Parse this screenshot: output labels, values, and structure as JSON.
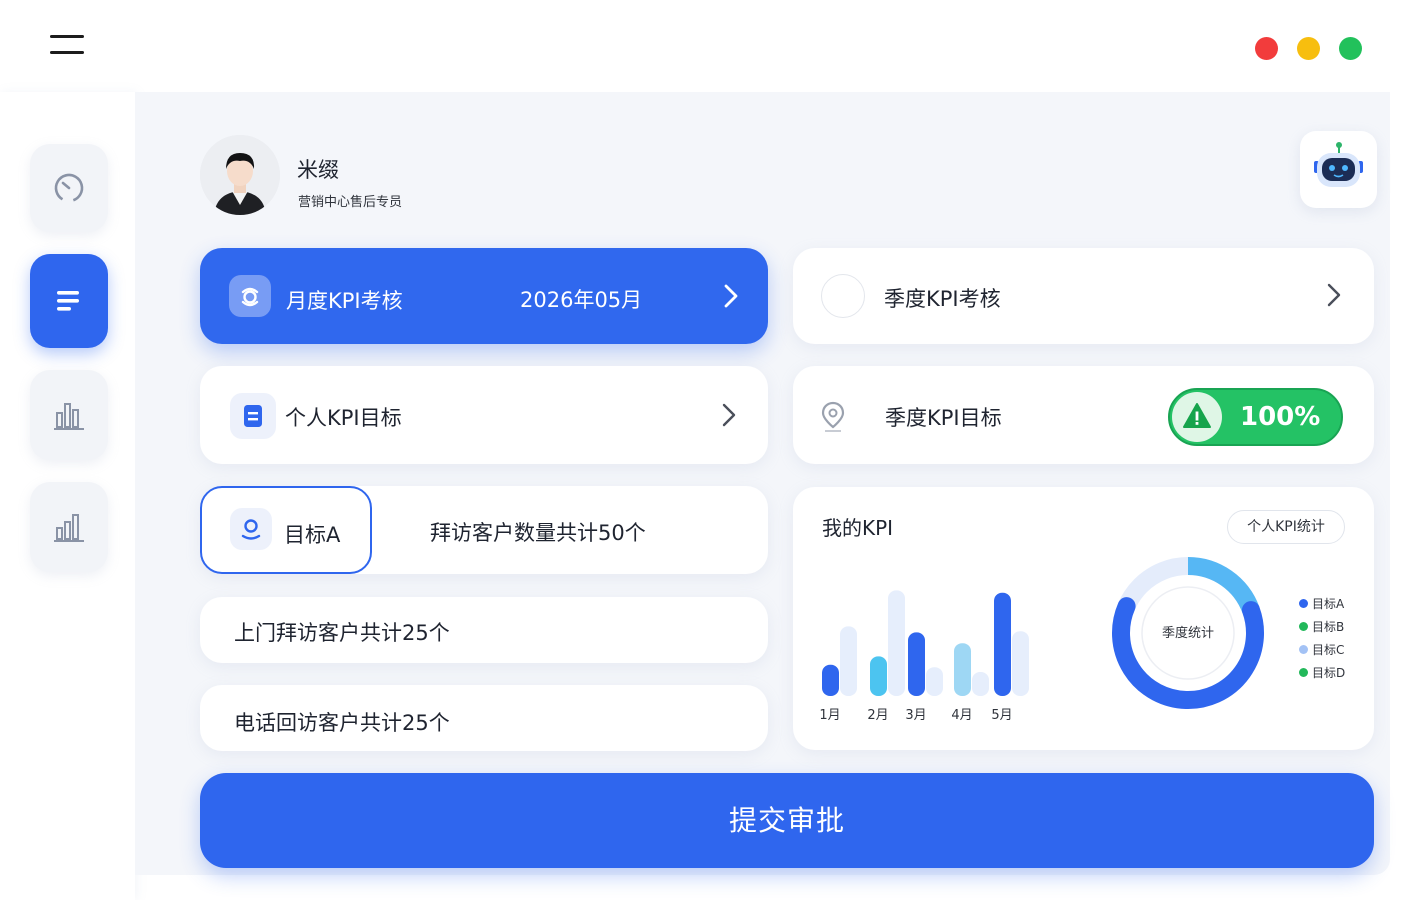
{
  "window": {
    "menu_icon": "hamburger-menu-icon",
    "controls": [
      {
        "name": "close",
        "color": "#f23c3c"
      },
      {
        "name": "minimize",
        "color": "#f7be0f"
      },
      {
        "name": "maximize",
        "color": "#22c15b"
      }
    ]
  },
  "sidebar": {
    "items": [
      {
        "icon": "speedometer-icon",
        "active": false
      },
      {
        "icon": "list-icon",
        "active": true
      },
      {
        "icon": "bar-chart-icon",
        "active": false
      },
      {
        "icon": "analytics-chart-icon",
        "active": false
      }
    ]
  },
  "user": {
    "name": "米缀",
    "role": "营销中心售后专员"
  },
  "cards": {
    "monthly": {
      "label": "月度KPI考核",
      "date": "2026年05月"
    },
    "quarterly": {
      "label": "季度KPI考核"
    },
    "personal_target": {
      "label": "个人KPI目标"
    },
    "quarterly_target": {
      "label": "季度KPI目标",
      "percent": "100%"
    }
  },
  "targets": {
    "a_label": "目标A",
    "a_desc": "拜访客户数量共计50个",
    "line2": "上门拜访客户共计25个",
    "line3": "电话回访客户共计25个"
  },
  "kpi": {
    "title": "我的KPI",
    "tag": "个人KPI统计",
    "donut_center": "季度统计"
  },
  "chart_data": [
    {
      "type": "bar",
      "categories": [
        "1月",
        "2月",
        "3月",
        "4月",
        "5月"
      ],
      "series": [
        {
          "values": [
            26,
            33,
            53,
            44,
            86
          ]
        },
        {
          "values": [
            58,
            88,
            24,
            20,
            54
          ]
        }
      ],
      "colors": {
        "primary": [
          "#2f66ee",
          "#4cc4f0",
          "#2f66ee",
          "#9ed7f4",
          "#2f66ee"
        ],
        "background": "#e6eefc"
      }
    },
    {
      "type": "pie",
      "labels": [
        "目标A",
        "目标B",
        "目标C",
        "目标D"
      ],
      "values": [
        51,
        19,
        0,
        0
      ],
      "colors": [
        "#2f66ee",
        "#22b85a",
        "#a3c2f5",
        "#22b85a"
      ],
      "track_color": "#e4ecfb",
      "highlight_color": "#56b7f4"
    }
  ],
  "submit": {
    "label": "提交审批"
  }
}
